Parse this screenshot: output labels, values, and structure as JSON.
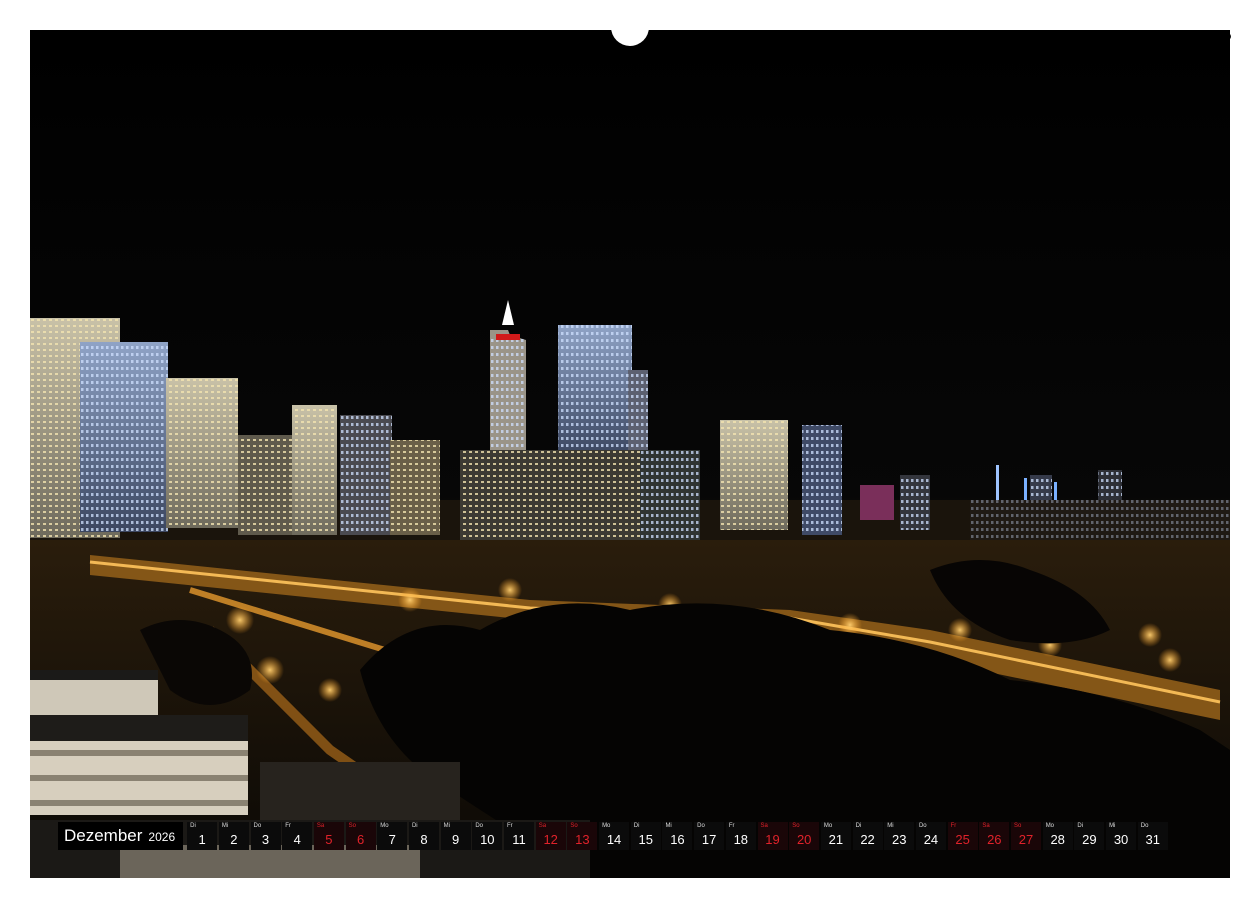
{
  "calendar": {
    "month": "Dezember",
    "year": "2026",
    "days": [
      {
        "d": "1",
        "w": "Di",
        "we": false
      },
      {
        "d": "2",
        "w": "Mi",
        "we": false
      },
      {
        "d": "3",
        "w": "Do",
        "we": false
      },
      {
        "d": "4",
        "w": "Fr",
        "we": false
      },
      {
        "d": "5",
        "w": "Sa",
        "we": true
      },
      {
        "d": "6",
        "w": "So",
        "we": true
      },
      {
        "d": "7",
        "w": "Mo",
        "we": false
      },
      {
        "d": "8",
        "w": "Di",
        "we": false
      },
      {
        "d": "9",
        "w": "Mi",
        "we": false
      },
      {
        "d": "10",
        "w": "Do",
        "we": false
      },
      {
        "d": "11",
        "w": "Fr",
        "we": false
      },
      {
        "d": "12",
        "w": "Sa",
        "we": true
      },
      {
        "d": "13",
        "w": "So",
        "we": true
      },
      {
        "d": "14",
        "w": "Mo",
        "we": false
      },
      {
        "d": "15",
        "w": "Di",
        "we": false
      },
      {
        "d": "16",
        "w": "Mi",
        "we": false
      },
      {
        "d": "17",
        "w": "Do",
        "we": false
      },
      {
        "d": "18",
        "w": "Fr",
        "we": false
      },
      {
        "d": "19",
        "w": "Sa",
        "we": true
      },
      {
        "d": "20",
        "w": "So",
        "we": true
      },
      {
        "d": "21",
        "w": "Mo",
        "we": false
      },
      {
        "d": "22",
        "w": "Di",
        "we": false
      },
      {
        "d": "23",
        "w": "Mi",
        "we": false
      },
      {
        "d": "24",
        "w": "Do",
        "we": false
      },
      {
        "d": "25",
        "w": "Fr",
        "we": true
      },
      {
        "d": "26",
        "w": "Sa",
        "we": true
      },
      {
        "d": "27",
        "w": "So",
        "we": true
      },
      {
        "d": "28",
        "w": "Mo",
        "we": false
      },
      {
        "d": "29",
        "w": "Di",
        "we": false
      },
      {
        "d": "30",
        "w": "Mi",
        "we": false
      },
      {
        "d": "31",
        "w": "Do",
        "we": false
      }
    ]
  },
  "photo": {
    "subject": "night-city-skyline",
    "colors": {
      "sky": "#050505",
      "streetlight": "#f2a437",
      "building_light": "#e8d9a8",
      "weekend": "#e0222a"
    }
  }
}
